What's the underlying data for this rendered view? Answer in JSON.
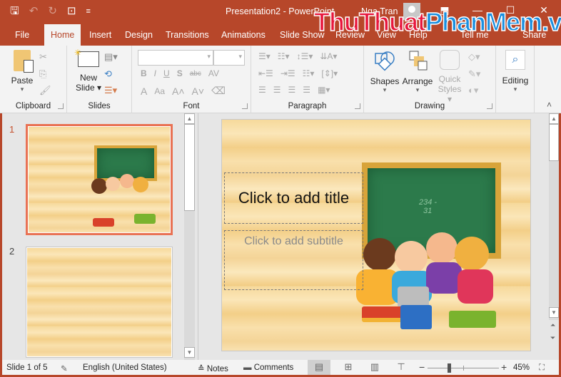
{
  "titlebar": {
    "document_title": "Presentation2 - PowerPoint",
    "user_name": "Nga Tran",
    "qat": {
      "save": "save-icon",
      "undo": "undo-icon",
      "redo": "redo-icon",
      "start_from_beginning": "slideshow-icon",
      "customize": "customize-qat-icon"
    },
    "window_controls": {
      "ribbon_display": "ribbon-display-options-icon",
      "minimize": "minimize-icon",
      "maximize": "maximize-icon",
      "close": "close-icon"
    },
    "symbols": {
      "save": "🖫",
      "undo": "↶",
      "redo": "↻",
      "present": "⊡",
      "customize": "≡",
      "ribbon": "⬒",
      "minimize": "—",
      "maximize": "☐",
      "close": "✕"
    }
  },
  "watermark": {
    "part1": "ThuThuat",
    "part2": "PhanMem.vn"
  },
  "tabs": [
    {
      "label": "File"
    },
    {
      "label": "Home",
      "active": true
    },
    {
      "label": "Insert"
    },
    {
      "label": "Design"
    },
    {
      "label": "Transitions"
    },
    {
      "label": "Animations"
    },
    {
      "label": "Slide Show"
    },
    {
      "label": "Review"
    },
    {
      "label": "View"
    },
    {
      "label": "Help"
    },
    {
      "label": "Tell me"
    },
    {
      "label": "Share"
    }
  ],
  "ribbon": {
    "clipboard": {
      "label": "Clipboard",
      "paste": "Paste",
      "dropdown": "▾"
    },
    "slides": {
      "label": "Slides",
      "new_slide_line1": "New",
      "new_slide_line2": "Slide ▾"
    },
    "font": {
      "label": "Font",
      "font_name": "",
      "font_size": "",
      "bold": "B",
      "italic": "I",
      "underline": "U",
      "shadow": "S",
      "strike": "abc",
      "spacing": "AV",
      "color": "A",
      "case": "Aa",
      "grow": "A˄",
      "shrink": "A˅",
      "clear": "⌫"
    },
    "paragraph": {
      "label": "Paragraph"
    },
    "drawing": {
      "label": "Drawing",
      "shapes": "Shapes",
      "arrange": "Arrange",
      "quick_styles_line1": "Quick",
      "quick_styles_line2": "Styles ▾"
    },
    "editing": {
      "label": "Editing",
      "icon": "⌕"
    },
    "collapse": "˄"
  },
  "thumbnails": [
    {
      "number": "1",
      "selected": true
    },
    {
      "number": "2",
      "selected": false
    }
  ],
  "slide": {
    "title_placeholder": "Click to add title",
    "subtitle_placeholder": "Click to add subtitle",
    "board_text_1": "234 -",
    "board_text_2": "31"
  },
  "status": {
    "slide_info": "Slide 1 of 5",
    "language": "English (United States)",
    "notes": "Notes",
    "comments": "Comments",
    "zoom": "45%",
    "zoom_fraction": 0.3,
    "views": [
      {
        "name": "normal-view",
        "symbol": "▤",
        "active": true
      },
      {
        "name": "slide-sorter",
        "symbol": "⊞",
        "active": false
      },
      {
        "name": "reading-view",
        "symbol": "▥",
        "active": false
      },
      {
        "name": "slide-show",
        "symbol": "⊤",
        "active": false
      }
    ]
  },
  "colors": {
    "accent": "#b7472a",
    "selection": "#e97254",
    "ribbon_bg": "#f3f3f3"
  }
}
